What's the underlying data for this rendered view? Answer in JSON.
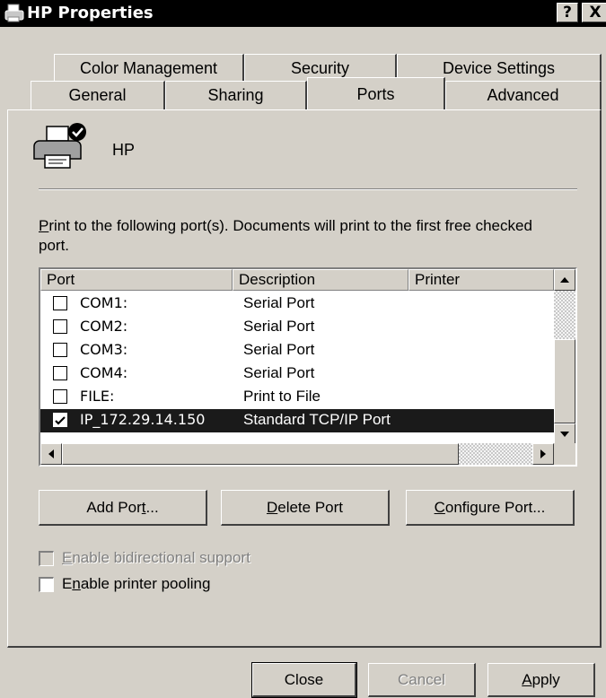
{
  "window": {
    "title": "HP Properties"
  },
  "title_buttons": {
    "help": "?",
    "close": "X"
  },
  "tabs_row1": [
    {
      "label": "Color Management"
    },
    {
      "label": "Security"
    },
    {
      "label": "Device Settings"
    }
  ],
  "tabs_row2": [
    {
      "label": "General"
    },
    {
      "label": "Sharing"
    },
    {
      "label": "Ports",
      "active": true
    },
    {
      "label": "Advanced"
    }
  ],
  "printer": {
    "name": "HP"
  },
  "instructions": {
    "accel": "P",
    "rest": "rint to the following port(s). Documents will print to the first free checked port."
  },
  "port_list": {
    "columns": [
      "Port",
      "Description",
      "Printer"
    ],
    "rows": [
      {
        "port": "COM1:",
        "description": "Serial Port",
        "checked": false
      },
      {
        "port": "COM2:",
        "description": "Serial Port",
        "checked": false
      },
      {
        "port": "COM3:",
        "description": "Serial Port",
        "checked": false
      },
      {
        "port": "COM4:",
        "description": "Serial Port",
        "checked": false
      },
      {
        "port": "FILE:",
        "description": "Print to File",
        "checked": false
      },
      {
        "port": "IP_172.29.14.150",
        "description": "Standard TCP/IP Port",
        "checked": true,
        "selected": true
      }
    ]
  },
  "buttons": {
    "add_port": {
      "pre": "Add Por",
      "accel": "t",
      "post": "..."
    },
    "delete_port": {
      "pre": "",
      "accel": "D",
      "post": "elete Port"
    },
    "configure_port": {
      "pre": "",
      "accel": "C",
      "post": "onfigure Port..."
    }
  },
  "options": {
    "bidirectional": {
      "accel": "E",
      "rest": "nable bidirectional support",
      "checked": false,
      "enabled": false
    },
    "pooling": {
      "pre": "E",
      "accel": "n",
      "rest": "able printer pooling",
      "checked": false,
      "enabled": true
    }
  },
  "footer": {
    "close": "Close",
    "cancel": "Cancel",
    "apply": {
      "accel": "A",
      "rest": "pply"
    }
  },
  "colors": {
    "titlebar": "#000000",
    "face": "#d4d0c8",
    "selection": "#1a1a1a"
  }
}
